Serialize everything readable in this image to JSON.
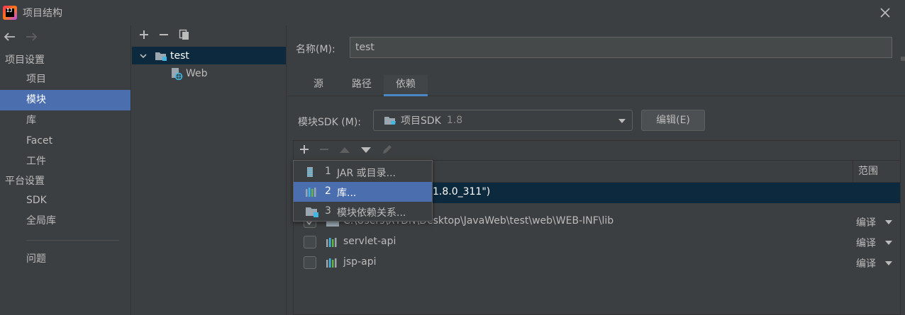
{
  "window": {
    "title": "项目结构",
    "app_icon_text": "IJ"
  },
  "nav": {
    "sections": [
      {
        "label": "项目设置",
        "items": [
          "项目",
          "模块",
          "库",
          "Facet",
          "工件"
        ]
      },
      {
        "label": "平台设置",
        "items": [
          "SDK",
          "全局库"
        ]
      }
    ],
    "selected": "模块",
    "problems": "问题"
  },
  "tree": {
    "nodes": [
      {
        "label": "test",
        "selected": true
      },
      {
        "label": "Web",
        "selected": false
      }
    ]
  },
  "module": {
    "name_label": "名称(M):",
    "name_value": "test",
    "tabs": [
      "源",
      "路径",
      "依赖"
    ],
    "active_tab": "依赖",
    "sdk_label": "模块SDK (M):",
    "sdk_value": "项目SDK",
    "sdk_version": "1.8",
    "edit_button": "编辑(E)"
  },
  "dependencies": {
    "scope_header": "范围",
    "jdk_row_text": "1.8.0_311\")",
    "rows": [
      {
        "name": "C:\\Users\\XYDN\\Desktop\\JavaWeb\\test\\web\\WEB-INF\\lib",
        "checked": true,
        "scope": "编译",
        "icon": "folder-icon"
      },
      {
        "name": "servlet-api",
        "checked": false,
        "scope": "编译",
        "icon": "library-icon"
      },
      {
        "name": "jsp-api",
        "checked": false,
        "scope": "编译",
        "icon": "library-icon"
      }
    ]
  },
  "popup": {
    "items": [
      {
        "num": "1",
        "label": "JAR 或目录...",
        "icon": "jar-icon"
      },
      {
        "num": "2",
        "label": "库...",
        "icon": "library-icon",
        "hover": true
      },
      {
        "num": "3",
        "label": "模块依赖关系...",
        "icon": "module-icon"
      }
    ]
  },
  "colors": {
    "background": "#3c3f41",
    "selection": "#4b6eaf",
    "selection_inactive": "#0d293e",
    "text": "#bbbbbb"
  }
}
